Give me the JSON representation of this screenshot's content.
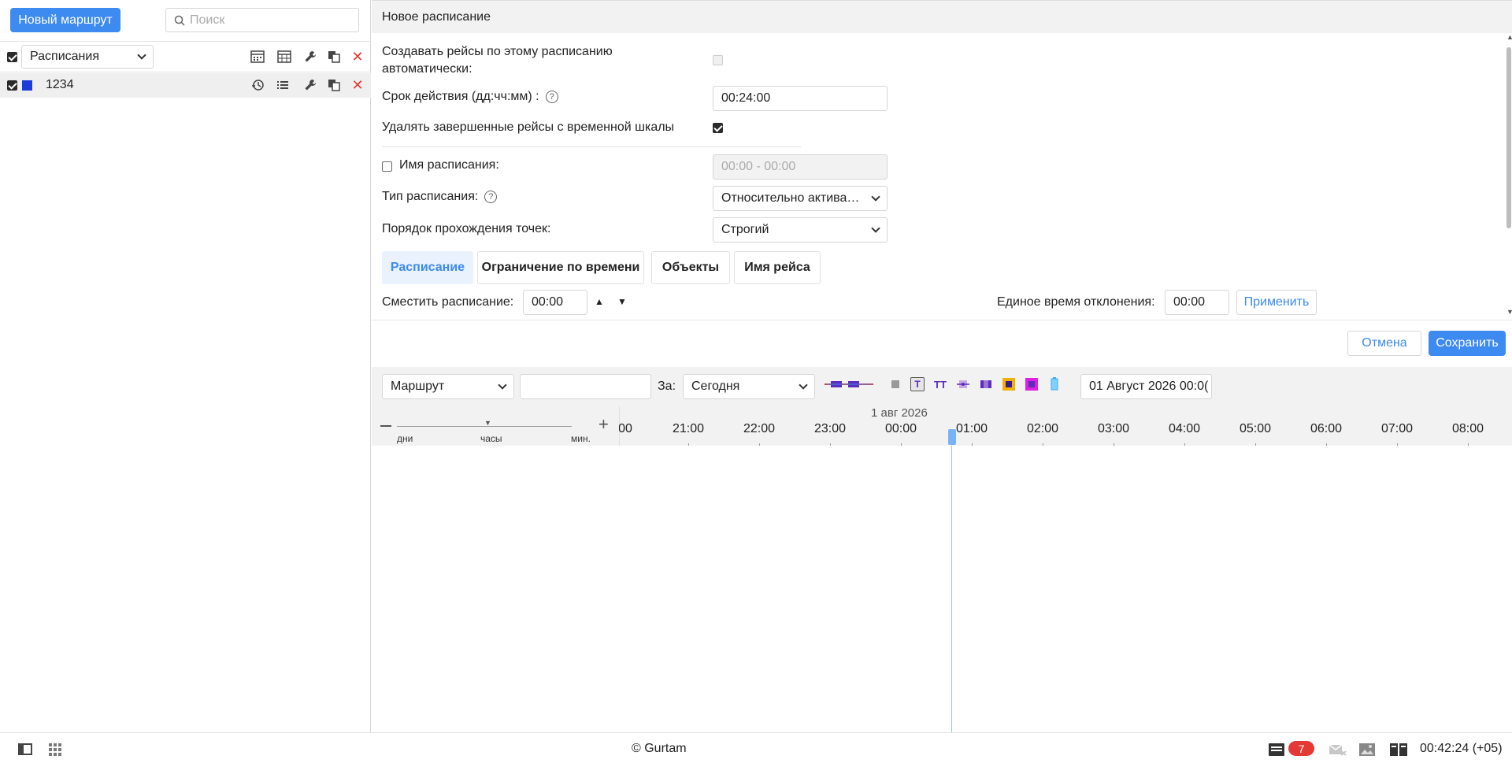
{
  "left": {
    "new_route_label": "Новый маршрут",
    "search_placeholder": "Поиск",
    "list_selector": "Расписания",
    "items": [
      {
        "name": "1234",
        "color": "#1a3cd8"
      }
    ]
  },
  "panel": {
    "title": "Новое расписание",
    "auto_create_label": "Создавать рейсы по этому расписанию автоматически:",
    "validity_label": "Срок действия (дд:чч:мм)  :",
    "validity_value": "00:24:00",
    "delete_finished_label": "Удалять завершенные рейсы с временной шкалы",
    "schedule_name_label": "Имя расписания:",
    "schedule_name_placeholder": "00:00 - 00:00",
    "schedule_type_label": "Тип расписания:",
    "schedule_type_value": "Относительно актива…",
    "points_order_label": "Порядок прохождения точек:",
    "points_order_value": "Строгий",
    "tabs": [
      "Расписание",
      "Ограничение по времени",
      "Объекты",
      "Имя рейса"
    ],
    "shift_label": "Сместить расписание:",
    "shift_value": "00:00",
    "deviation_label": "Единое время отклонения:",
    "deviation_value": "00:00",
    "apply_label": "Применить",
    "cancel_label": "Отмена",
    "save_label": "Сохранить"
  },
  "timeline_toolbar": {
    "mode_value": "Маршрут",
    "filter_value": "",
    "period_label": "За:",
    "period_value": "Сегодня",
    "date_value": "01 Август 2026 00:0("
  },
  "timeline": {
    "date_label": "1 авг 2026",
    "scale_labels": [
      "дни",
      "часы",
      "мин."
    ],
    "hours": [
      "00",
      "21:00",
      "22:00",
      "23:00",
      "00:00",
      "01:00",
      "02:00",
      "03:00",
      "04:00",
      "05:00",
      "06:00",
      "07:00",
      "08:00"
    ]
  },
  "footer": {
    "copyright": "© Gurtam",
    "notifications_count": "7",
    "clock": "00:42:24 (+05)"
  },
  "colors": {
    "accent": "#3d8af0",
    "danger": "#e53935",
    "badge": "#e53935"
  }
}
